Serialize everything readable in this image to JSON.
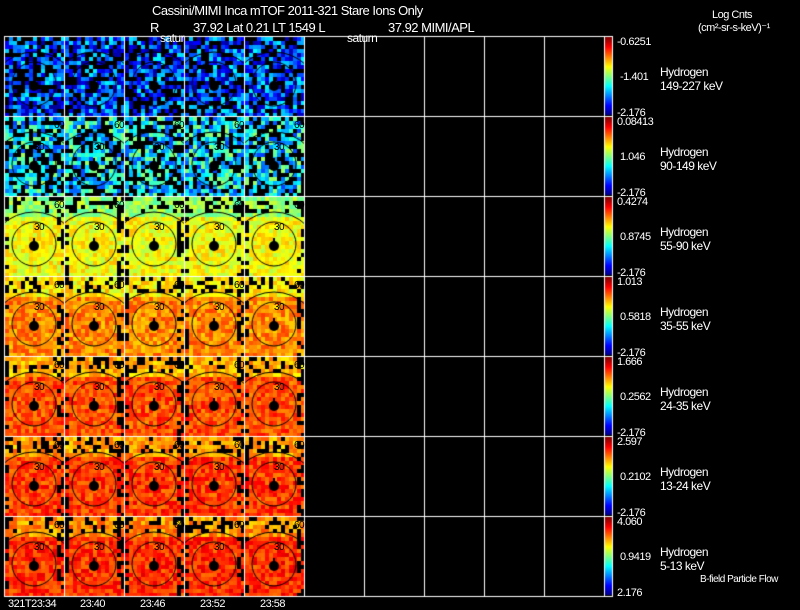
{
  "header": {
    "title": "Cassini/MIMI Inca mTOF  2011-321    Stare    Ions Only",
    "subtitle_r": "R",
    "subtitle_rest": "37.92 Lat 0.21 LT 1549 L",
    "subtitle_l": "37.92  MIMI/APL",
    "label_satur": "satur",
    "label_saturn": "saturn"
  },
  "units": {
    "line1": "Log Cnts",
    "line2": "(cm²-sr-s-keV)⁻¹"
  },
  "footer_label": "B-field Particle Flow",
  "time_labels": [
    "321T23:34",
    "23:40",
    "23:46",
    "23:52",
    "23:58"
  ],
  "contour_labels": [
    "60",
    "30"
  ],
  "rows": [
    {
      "species": "Hydrogen",
      "energy": "149-227 keV",
      "max": "-0.6251",
      "mid": "-1.401",
      "min": "-2.176",
      "level": 0.2
    },
    {
      "species": "Hydrogen",
      "energy": "90-149 keV",
      "max": "0.08413",
      "mid": "1.046",
      "min": "-2.176",
      "level": 0.36
    },
    {
      "species": "Hydrogen",
      "energy": "55-90 keV",
      "max": "0.4274",
      "mid": "0.8745",
      "min": "-2.176",
      "level": 0.62
    },
    {
      "species": "Hydrogen",
      "energy": "35-55 keV",
      "max": "1.013",
      "mid": "0.5818",
      "min": "-2.176",
      "level": 0.74
    },
    {
      "species": "Hydrogen",
      "energy": "24-35 keV",
      "max": "1.666",
      "mid": "0.2562",
      "min": "-2.176",
      "level": 0.8
    },
    {
      "species": "Hydrogen",
      "energy": "13-24 keV",
      "max": "2.597",
      "mid": "0.2102",
      "min": "-2.176",
      "level": 0.82
    },
    {
      "species": "Hydrogen",
      "energy": "5-13 keV",
      "max": "4.060",
      "mid": "0.9419",
      "min": "2.176",
      "level": 0.83
    }
  ],
  "chart_data": {
    "type": "heatmap",
    "title": "Cassini/MIMI Inca mTOF 2011-321 Stare Ions Only",
    "colorbar_title": "Log Cnts (cm2-sr-s-keV)-1",
    "columns_total": 10,
    "columns_with_data": 5,
    "x_tick_labels": [
      "321T23:34",
      "23:40",
      "23:46",
      "23:52",
      "23:58"
    ],
    "rows": [
      "149-227 keV",
      "90-149 keV",
      "55-90 keV",
      "35-55 keV",
      "24-35 keV",
      "13-24 keV",
      "5-13 keV"
    ]
  }
}
